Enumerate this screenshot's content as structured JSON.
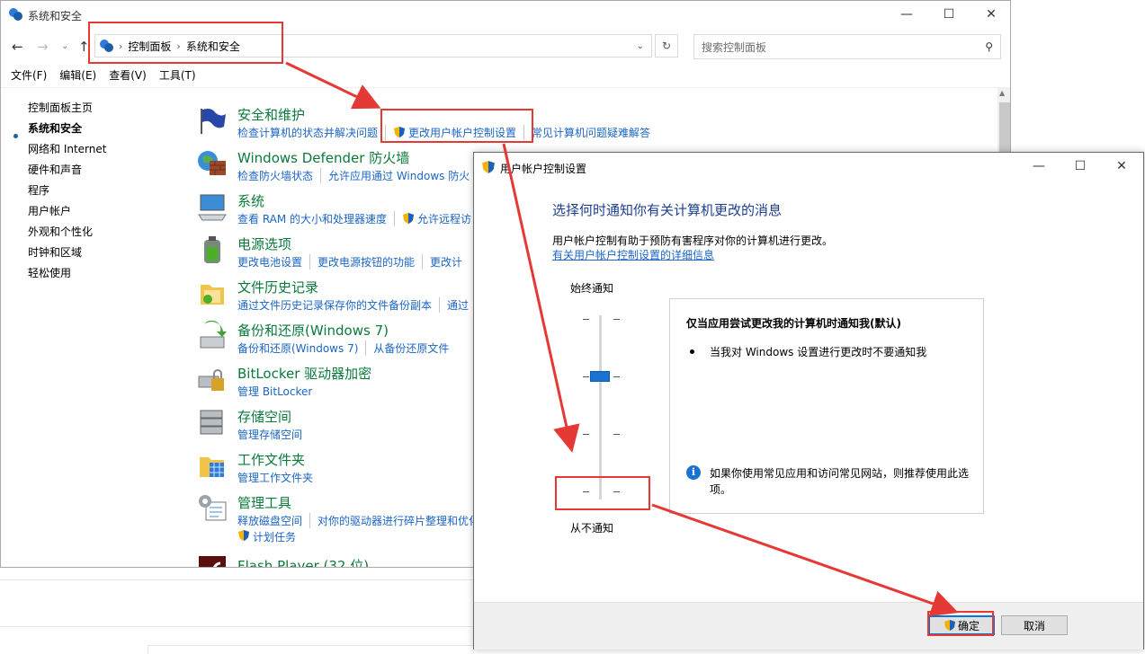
{
  "control_panel": {
    "title": "系统和安全",
    "breadcrumbs": [
      "控制面板",
      "系统和安全"
    ],
    "search_placeholder": "搜索控制面板",
    "menu": [
      "文件(F)",
      "编辑(E)",
      "查看(V)",
      "工具(T)"
    ],
    "left_nav": [
      "控制面板主页",
      "系统和安全",
      "网络和 Internet",
      "硬件和声音",
      "程序",
      "用户帐户",
      "外观和个性化",
      "时钟和区域",
      "轻松使用"
    ],
    "categories": [
      {
        "title": "安全和维护",
        "links": [
          "检查计算机的状态并解决问题",
          "更改用户帐户控制设置",
          "常见计算机问题疑难解答"
        ]
      },
      {
        "title": "Windows Defender 防火墙",
        "links": [
          "检查防火墙状态",
          "允许应用通过 Windows 防火"
        ]
      },
      {
        "title": "系统",
        "links": [
          "查看 RAM 的大小和处理器速度",
          "允许远程访"
        ]
      },
      {
        "title": "电源选项",
        "links": [
          "更改电池设置",
          "更改电源按钮的功能",
          "更改计"
        ]
      },
      {
        "title": "文件历史记录",
        "links": [
          "通过文件历史记录保存你的文件备份副本",
          "通过"
        ]
      },
      {
        "title": "备份和还原(Windows 7)",
        "links": [
          "备份和还原(Windows 7)",
          "从备份还原文件"
        ]
      },
      {
        "title": "BitLocker 驱动器加密",
        "links": [
          "管理 BitLocker"
        ]
      },
      {
        "title": "存储空间",
        "links": [
          "管理存储空间"
        ]
      },
      {
        "title": "工作文件夹",
        "links": [
          "管理工作文件夹"
        ]
      },
      {
        "title": "管理工具",
        "links": [
          "释放磁盘空间",
          "对你的驱动器进行碎片整理和优化"
        ],
        "extra_link": "计划任务"
      },
      {
        "title": "Flash Player (32 位)",
        "links": []
      }
    ]
  },
  "uac": {
    "title": "用户帐户控制设置",
    "heading": "选择何时通知你有关计算机更改的消息",
    "description": "用户帐户控制有助于预防有害程序对你的计算机进行更改。",
    "link": "有关用户帐户控制设置的详细信息",
    "slider_top": "始终通知",
    "slider_bottom": "从不通知",
    "slider_level": "3 of 4 (from bottom)",
    "box_title": "仅当应用尝试更改我的计算机时通知我(默认)",
    "box_bullet": "当我对 Windows 设置进行更改时不要通知我",
    "box_info": "如果你使用常见应用和访问常见网站，则推荐使用此选项。",
    "ok": "确定",
    "cancel": "取消"
  },
  "colors": {
    "annotation": "#e53935",
    "link": "#1b65c6",
    "heading_green": "#0a7a3a",
    "uac_heading": "#1d3f8e",
    "accent": "#1a73d0"
  }
}
